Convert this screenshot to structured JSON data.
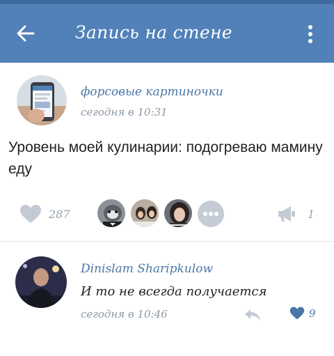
{
  "header": {
    "title": "Запись на стене",
    "back_icon": "arrow-left-icon",
    "menu_icon": "more-vertical-icon",
    "background_color": "#5181b8"
  },
  "post": {
    "author": "форсовые картиночки",
    "time": "сегодня в 10:31",
    "text": "Уровень моей кулинарии: подогреваю мамину еду",
    "likes": "287",
    "shares": "1",
    "like_icon": "heart-icon",
    "share_icon": "megaphone-icon",
    "more_likers_icon": "more-horizontal-icon"
  },
  "comment": {
    "author": "Dinislam Sharipkulow",
    "text": "И то не всегда получается",
    "time": "сегодня в 10:46",
    "likes": "9",
    "reply_icon": "reply-arrow-icon",
    "like_icon": "heart-icon",
    "liked": true
  },
  "colors": {
    "accent": "#4a76a8",
    "muted": "#8c98a5",
    "icon_gray": "#c3cad3"
  }
}
